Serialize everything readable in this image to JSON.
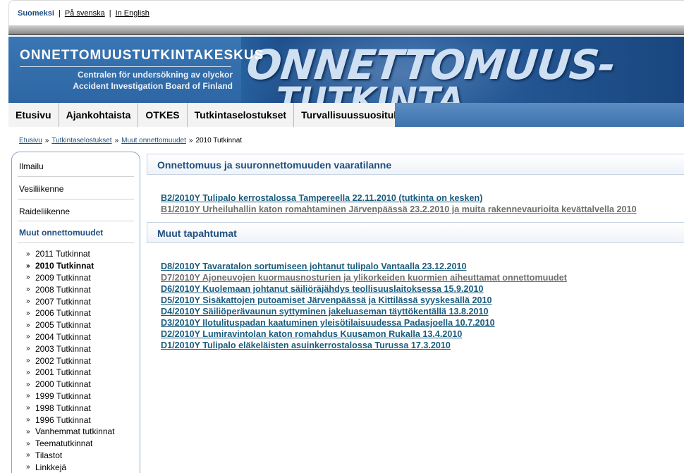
{
  "lang": {
    "current": "Suomeksi",
    "swedish": "På svenska",
    "english": "In English"
  },
  "banner": {
    "org_name": "ONNETTOMUUSTUTKINTAKESKUS",
    "sub_sv": "Centralen för undersökning av olyckor",
    "sub_en": "Accident Investigation Board of Finland",
    "graphic_line1": "ONNETTOMUUS-",
    "graphic_line2": "TUTKINTA"
  },
  "nav": {
    "items": [
      "Etusivu",
      "Ajankohtaista",
      "OTKES",
      "Tutkintaselostukset",
      "Turvallisuussuositukset"
    ]
  },
  "breadcrumb": {
    "items": [
      "Etusivu",
      "Tutkintaselostukset",
      "Muut onnettomuudet"
    ],
    "separator": "»",
    "current": "2010 Tutkinnat"
  },
  "sidebar": {
    "top_links": [
      "Ilmailu",
      "Vesiliikenne",
      "Raideliikenne",
      "Muut onnettomuudet"
    ],
    "sub_bullet": "»",
    "sub_items": [
      "2011 Tutkinnat",
      "2010 Tutkinnat",
      "2009 Tutkinnat",
      "2008 Tutkinnat",
      "2007 Tutkinnat",
      "2006 Tutkinnat",
      "2005 Tutkinnat",
      "2004 Tutkinnat",
      "2003 Tutkinnat",
      "2002 Tutkinnat",
      "2001 Tutkinnat",
      "2000 Tutkinnat",
      "1999 Tutkinnat",
      "1998 Tutkinnat",
      "1996 Tutkinnat",
      "Vanhemmat tutkinnat",
      "Teematutkinnat",
      "Tilastot",
      "Linkkejä"
    ]
  },
  "sections": [
    {
      "title": "Onnettomuus ja suuronnettomuuden vaaratilanne",
      "links": [
        {
          "text": "B2/2010Y Tulipalo kerrostalossa Tampereella 22.11.2010 (tutkinta on kesken)",
          "style": "blue"
        },
        {
          "text": "B1/2010Y Urheiluhallin katon romahtaminen Järvenpäässä 23.2.2010 ja muita rakennevaurioita kevättalvella 2010",
          "style": "gray"
        }
      ]
    },
    {
      "title": "Muut tapahtumat",
      "links": [
        {
          "text": "D8/2010Y Tavaratalon sortumiseen johtanut tulipalo Vantaalla 23.12.2010",
          "style": "blue"
        },
        {
          "text": "D7/2010Y Ajoneuvojen kuormausnosturien ja ylikorkeiden kuormien aiheuttamat onnettomuudet",
          "style": "gray"
        },
        {
          "text": "D6/2010Y Kuolemaan johtanut säiliöräjähdys teollisuuslaitoksessa 15.9.2010",
          "style": "blue"
        },
        {
          "text": "D5/2010Y Sisäkattojen putoamiset Järvenpäässä ja Kittilässä syyskesällä 2010",
          "style": "blue"
        },
        {
          "text": "D4/2010Y Säiliöperävaunun syttyminen jakeluaseman täyttökentällä 13.8.2010",
          "style": "blue"
        },
        {
          "text": "D3/2010Y Ilotulituspadan kaatuminen yleisötilaisuudessa Padasjoella 10.7.2010",
          "style": "blue"
        },
        {
          "text": "D2/2010Y Lumiravintolan katon romahdus Kuusamon Rukalla 13.4.2010",
          "style": "blue"
        },
        {
          "text": "D1/2010Y Tulipalo eläkeläisten asuinkerrostalossa Turussa 17.3.2010",
          "style": "blue"
        }
      ]
    }
  ]
}
